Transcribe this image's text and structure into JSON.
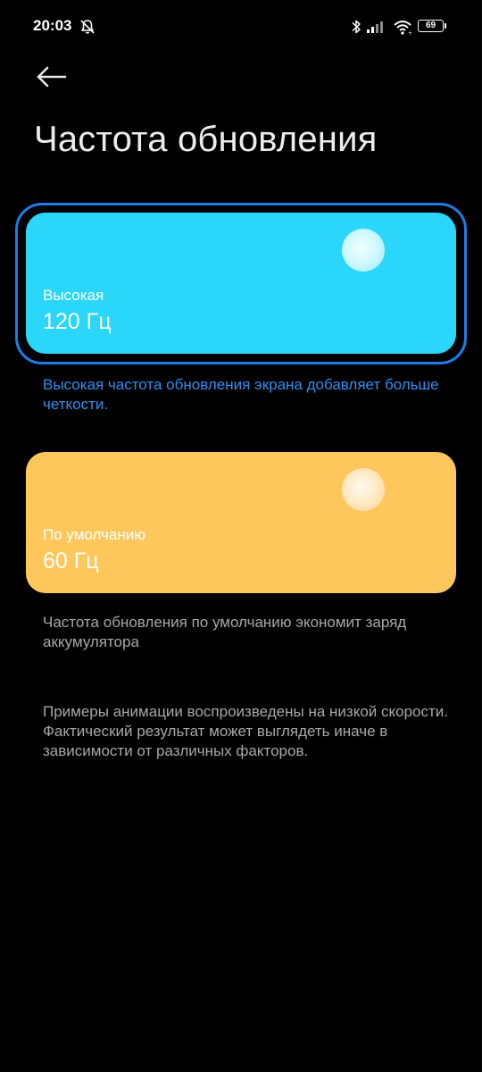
{
  "status_bar": {
    "time": "20:03",
    "battery_level": "69",
    "icons": [
      "bell-off-icon",
      "bluetooth-icon",
      "signal-icon",
      "wifi-icon",
      "battery-icon"
    ]
  },
  "header": {
    "back_icon": "arrow-left-icon",
    "title": "Частота обновления"
  },
  "options": [
    {
      "label": "Высокая",
      "value": "120 Гц",
      "selected": true,
      "color": "#2ad6fa",
      "description": "Высокая частота обновления экрана добавляет больше четкости."
    },
    {
      "label": "По умолчанию",
      "value": "60 Гц",
      "selected": false,
      "color": "#fec75b",
      "description": "Частота обновления по умолчанию экономит заряд аккумулятора"
    }
  ],
  "disclaimer": "Примеры анимации воспроизведены на низкой скорости. Фактический результат может выглядеть иначе в зависимости от различных факторов.",
  "colors": {
    "accent": "#1e7de6",
    "description_selected": "#2f8ff0",
    "description_default": "#a8a8a8"
  }
}
